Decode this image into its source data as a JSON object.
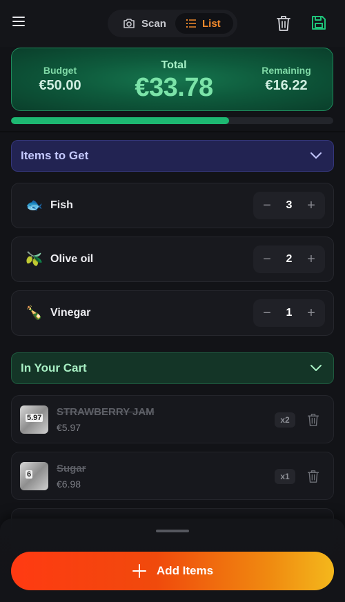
{
  "header": {
    "tabs": [
      {
        "label": "Scan",
        "icon": "camera-icon",
        "active": false
      },
      {
        "label": "List",
        "icon": "list-icon",
        "active": true
      }
    ],
    "accent_color": "#f38a2c"
  },
  "budget": {
    "budget_label": "Budget",
    "budget_value": "€50.00",
    "total_label": "Total",
    "total_value": "€33.78",
    "remaining_label": "Remaining",
    "remaining_value": "€16.22",
    "spent_fraction": 0.676
  },
  "sections": {
    "to_get_title": "Items to Get",
    "cart_title": "In Your Cart"
  },
  "items_to_get": [
    {
      "emoji": "🐟",
      "name": "Fish",
      "qty": "3"
    },
    {
      "emoji": "🫒",
      "name": "Olive oil",
      "qty": "2"
    },
    {
      "emoji": "🍾",
      "name": "Vinegar",
      "qty": "1"
    }
  ],
  "cart": [
    {
      "name": "STRAWBERRY JAM",
      "price": "€5.97",
      "qty": "x2",
      "thumb_text": "5.97"
    },
    {
      "name": "Sugar",
      "price": "€6.98",
      "qty": "x1",
      "thumb_text": "6"
    }
  ],
  "add_button_label": "Add Items"
}
